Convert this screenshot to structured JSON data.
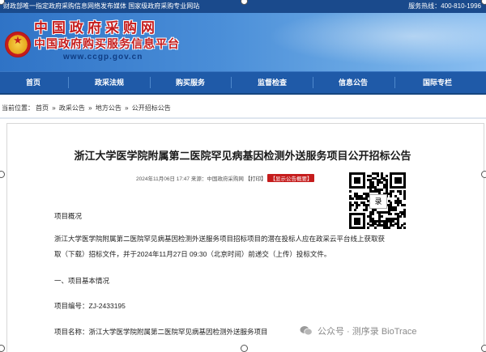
{
  "topbar": {
    "left_text": "财政部唯一指定政府采购信息网络发布媒体  国家级政府采购专业网站",
    "hotline": "服务热线：400-810-1996"
  },
  "banner": {
    "logo_line1": "中国政府采购网",
    "logo_line2": "中国政府购买服务信息平台",
    "logo_url": "www.ccgp.gov.cn"
  },
  "nav": {
    "items": [
      "首页",
      "政采法规",
      "购买服务",
      "监督检查",
      "信息公告",
      "国际专栏"
    ]
  },
  "breadcrumb": {
    "label": "当前位置：",
    "items": [
      "首页",
      "政采公告",
      "地方公告",
      "公开招标公告"
    ],
    "separator": "»"
  },
  "article": {
    "title": "浙江大学医学院附属第二医院罕见病基因检测外送服务项目公开招标公告",
    "date": "2024年11月06日 17:47",
    "source_label": "来源：",
    "source": "中国政府采购网",
    "print_label": "【打印】",
    "badge_label": "【显示公告概要】",
    "sections": {
      "overview_heading": "项目概况",
      "overview_line1": "浙江大学医学院附属第二医院罕见病基因检测外送服务项目招标项目的潜在投标人应在政采云平台线上获取获",
      "overview_line2": "取（下载）招标文件，并于2024年11月27日 09:30（北京时间）前递交（上传）投标文件。",
      "basic_heading": "一、项目基本情况",
      "project_no_label": "项目编号：",
      "project_no": "ZJ-2433195",
      "project_name_label": "项目名称：",
      "project_name": "浙江大学医学院附属第二医院罕见病基因检测外送服务项目"
    }
  },
  "qr": {
    "center_glyph": "录"
  },
  "watermark": {
    "text": "公众号 · 测序录 BioTrace",
    "icon": "wechat-icon"
  },
  "colors": {
    "topbar": "#1a4a8c",
    "nav": "#1f5aa8",
    "logo_red": "#c51c1c",
    "badge_red": "#c51c1c"
  }
}
